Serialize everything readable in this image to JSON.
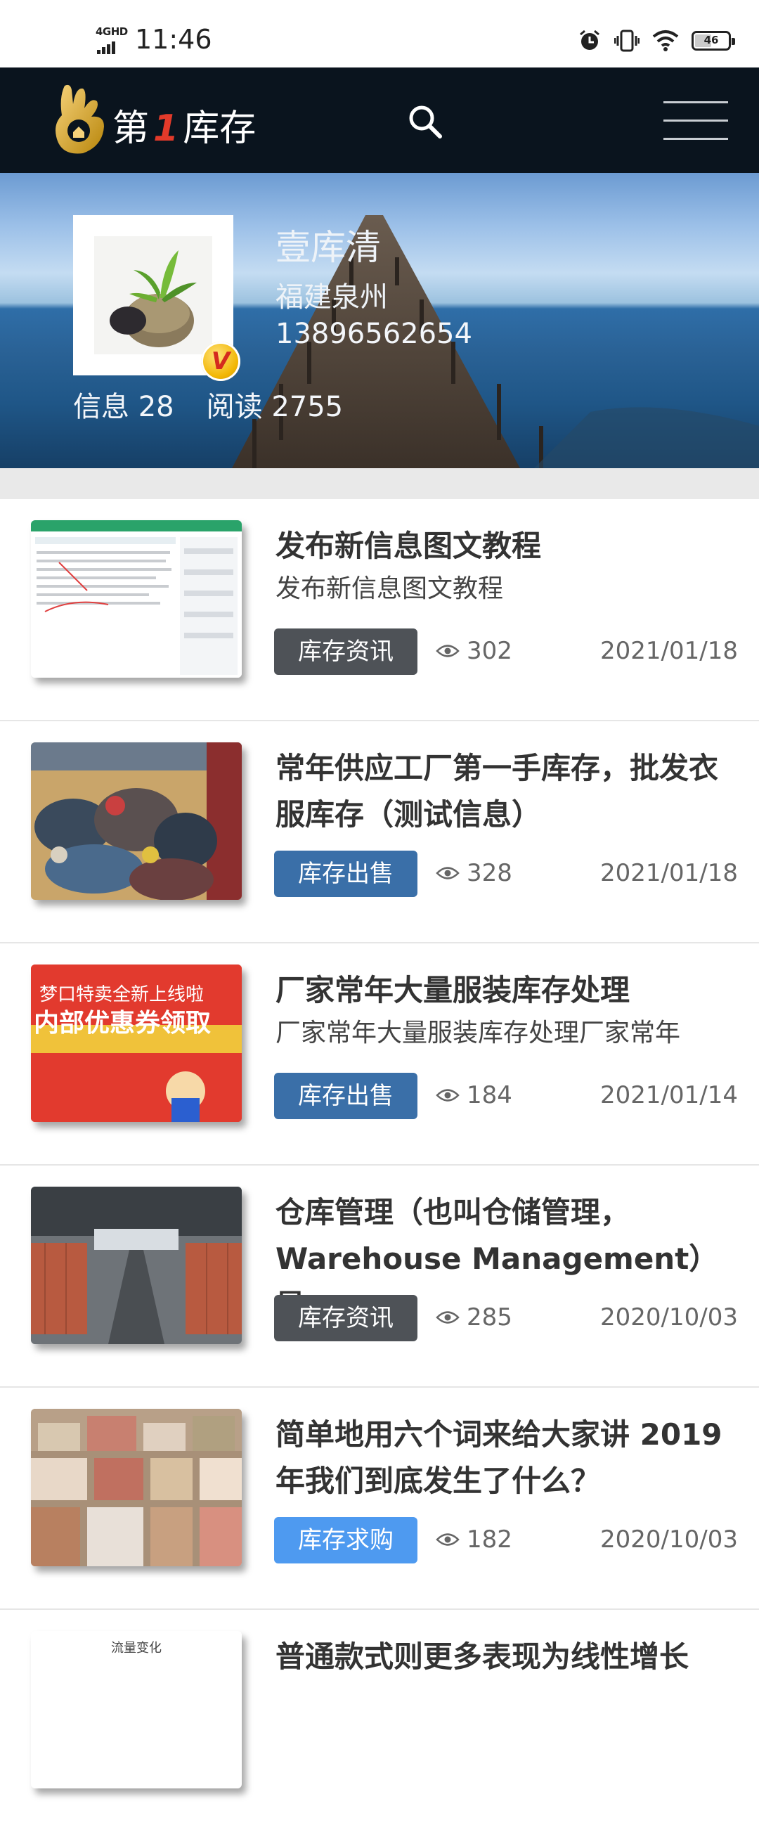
{
  "status_bar": {
    "network": "4GHD",
    "time": "11:46",
    "battery": "46"
  },
  "header": {
    "brand_prefix": "第",
    "brand_num": "1",
    "brand_suffix": "库存"
  },
  "profile": {
    "name": "壹库清",
    "location": "福建泉州",
    "phone": "13896562654",
    "stats": {
      "info": "信息 28",
      "reads": "阅读 2755"
    },
    "badge": "V"
  },
  "colors": {
    "tag_dark": "#4e5257",
    "tag_blue": "#3a6fa8",
    "tag_light": "#4e9af0"
  },
  "posts": [
    {
      "title": "发布新信息图文教程",
      "subtitle": "发布新信息图文教程",
      "tag": "库存资讯",
      "views": "302",
      "date": "2021/01/18"
    },
    {
      "title": "常年供应工厂第一手库存，批发衣服库存（测试信息）",
      "subtitle": "",
      "tag": "库存出售",
      "views": "328",
      "date": "2021/01/18"
    },
    {
      "title": "厂家常年大量服装库存处理",
      "subtitle": "厂家常年大量服装库存处理厂家常年",
      "tag": "库存出售",
      "views": "184",
      "date": "2021/01/14",
      "thumb_text_1": "梦口特卖全新上线啦",
      "thumb_text_2": "内部优惠券领取"
    },
    {
      "title": "仓库管理（也叫仓储管理，Warehouse Management）是",
      "subtitle": "",
      "tag": "库存资讯",
      "views": "285",
      "date": "2020/10/03"
    },
    {
      "title": "简单地用六个词来给大家讲 2019 年我们到底发生了什么？",
      "subtitle": "",
      "tag": "库存求购",
      "views": "182",
      "date": "2020/10/03"
    },
    {
      "title": "普通款式则更多表现为线性增长",
      "subtitle": "",
      "thumb_text_1": "流量变化"
    }
  ]
}
